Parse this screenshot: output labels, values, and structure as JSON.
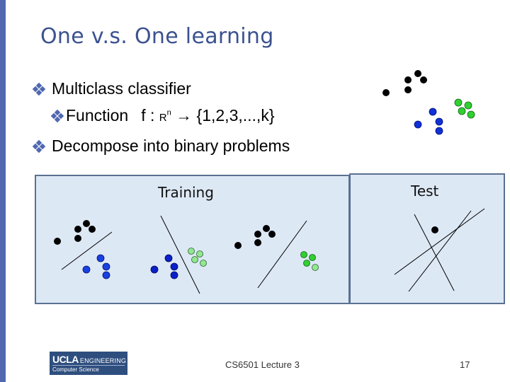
{
  "slide": {
    "title": "One v.s. One learning",
    "bullets": [
      {
        "text": "Multiclass classifier"
      },
      {
        "text": "Function",
        "formula_f": "f :",
        "formula_r": "R",
        "formula_sup": "n",
        "formula_arrow": "→",
        "formula_set": "{1,2,3,...,k}"
      },
      {
        "text": "Decompose into binary problems"
      }
    ],
    "panels": {
      "training_label": "Training",
      "test_label": "Test"
    },
    "colors": {
      "accent": "#4f68b0",
      "title": "#3b5290",
      "panel_bg": "#dde8f5",
      "panel_border": "#5a7191",
      "class_black": "#000000",
      "class_blue": "#1030d8",
      "class_green": "#30d030",
      "class_light_green": "#90e890"
    },
    "footer": {
      "logo_main": "UCLA",
      "logo_sub": "ENGINEERING",
      "logo_dept": "Computer Science",
      "course": "CS6501 Lecture 3",
      "page_number": "17"
    }
  }
}
